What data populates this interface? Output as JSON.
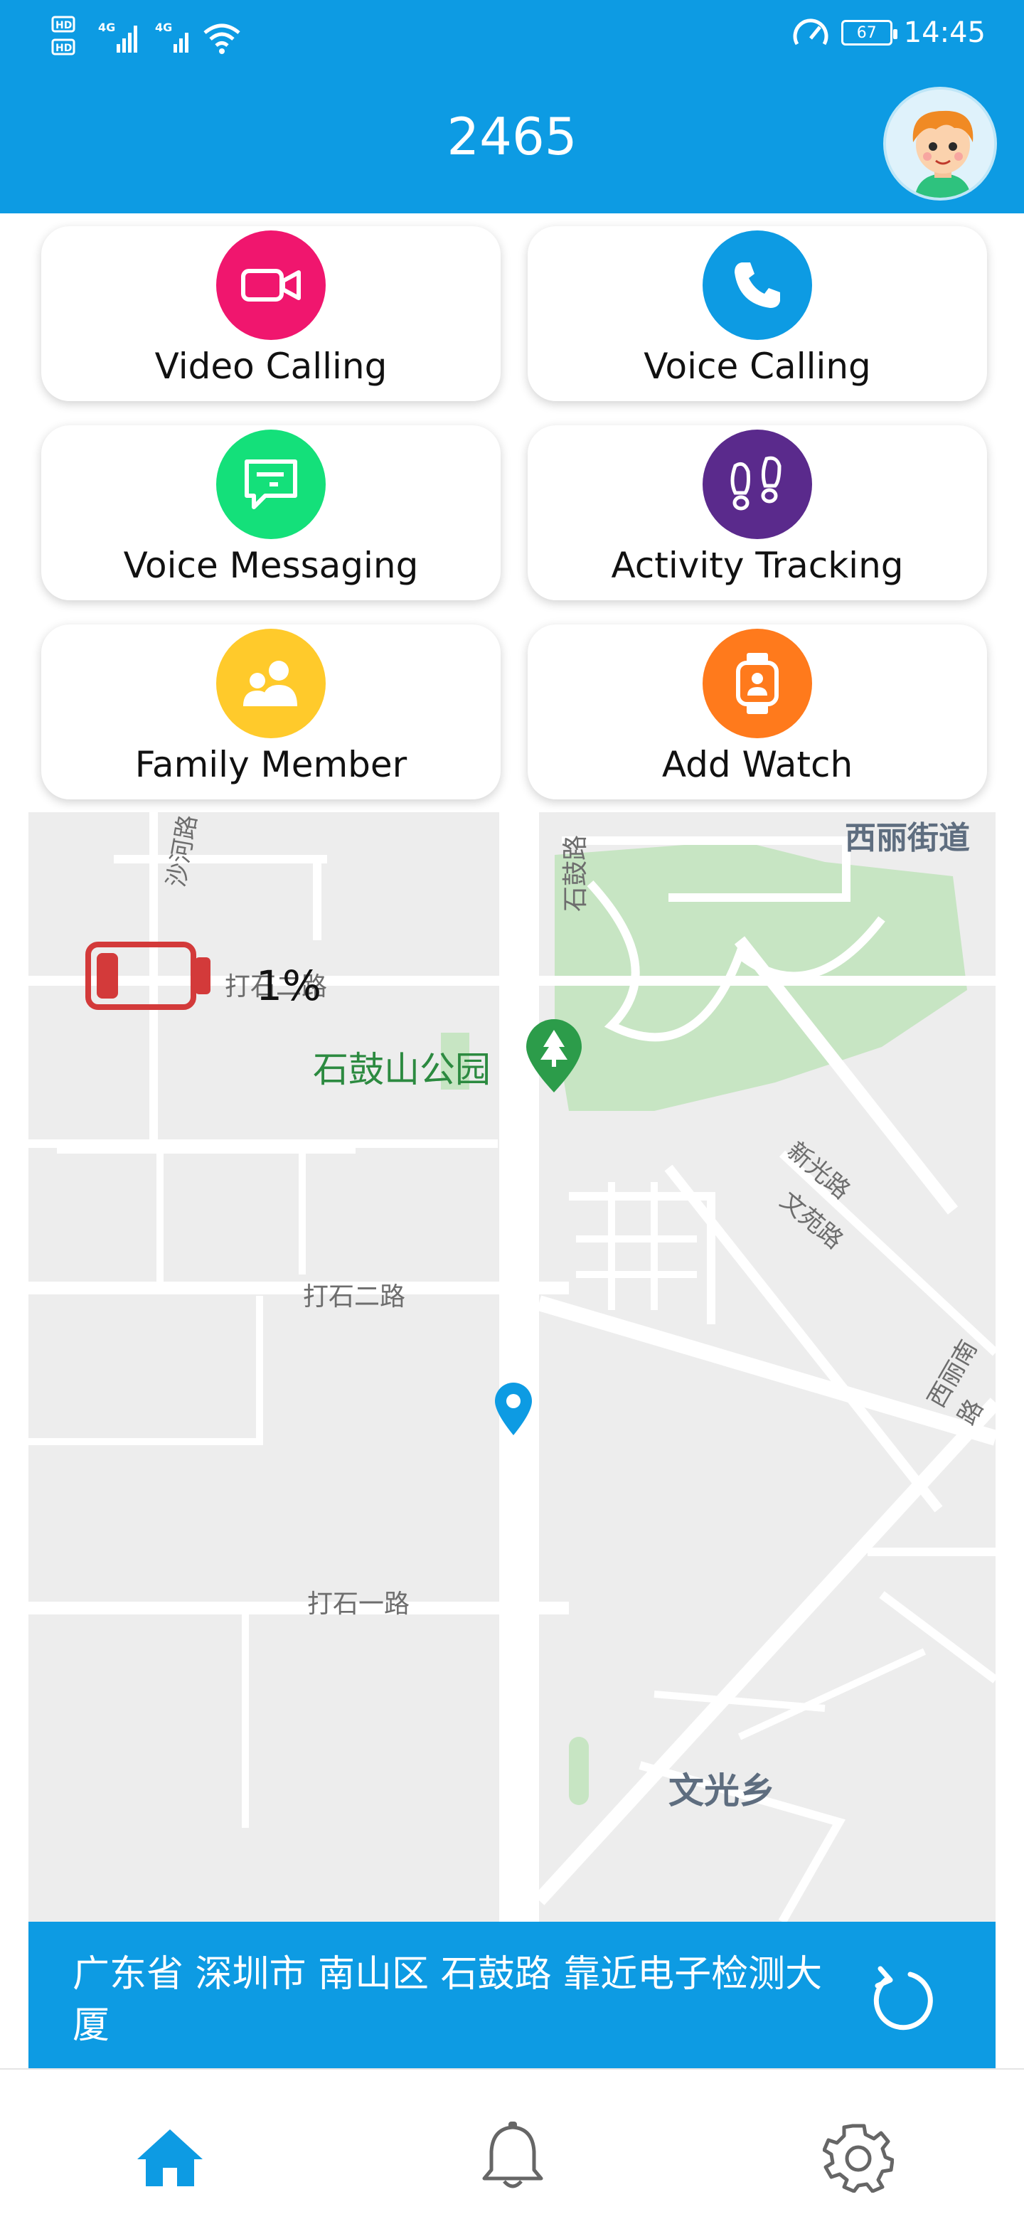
{
  "status_bar": {
    "left": "HD 4G 4G",
    "battery": "67",
    "time": "14:45"
  },
  "header": {
    "title": "2465"
  },
  "features": [
    {
      "label": "Video Calling",
      "icon": "video-camera-icon",
      "color": "#f0166e"
    },
    {
      "label": "Voice Calling",
      "icon": "phone-icon",
      "color": "#0d9be3"
    },
    {
      "label": "Voice Messaging",
      "icon": "message-icon",
      "color": "#14e07a"
    },
    {
      "label": "Activity Tracking",
      "icon": "footprints-icon",
      "color": "#5a2a8c"
    },
    {
      "label": "Family Member",
      "icon": "family-icon",
      "color": "#ffca2b"
    },
    {
      "label": "Add Watch",
      "icon": "watch-icon",
      "color": "#ff7a1c"
    }
  ],
  "map": {
    "battery_percent": "1%",
    "labels": {
      "xili_street": "西丽街道",
      "shahe_rd": "沙河路",
      "dashi_rd_top": "打石二路",
      "shigu_rd": "石鼓路",
      "park": "石鼓山公园",
      "xinguang_rd": "新光路",
      "wenyuan_rd": "文苑路",
      "dashi_2": "打石二路",
      "xili_south_rd": "西丽南路",
      "dashi_1": "打石一路",
      "wenguang": "文光乡"
    }
  },
  "address": {
    "text": "广东省 深圳市 南山区 石鼓路 靠近电子检测大厦"
  },
  "nav": {
    "home": "home-icon",
    "alerts": "bell-icon",
    "settings": "gear-icon"
  },
  "colors": {
    "primary": "#0d9be3",
    "battery_low": "#d33a3a",
    "park_green": "#c7e5c3"
  }
}
